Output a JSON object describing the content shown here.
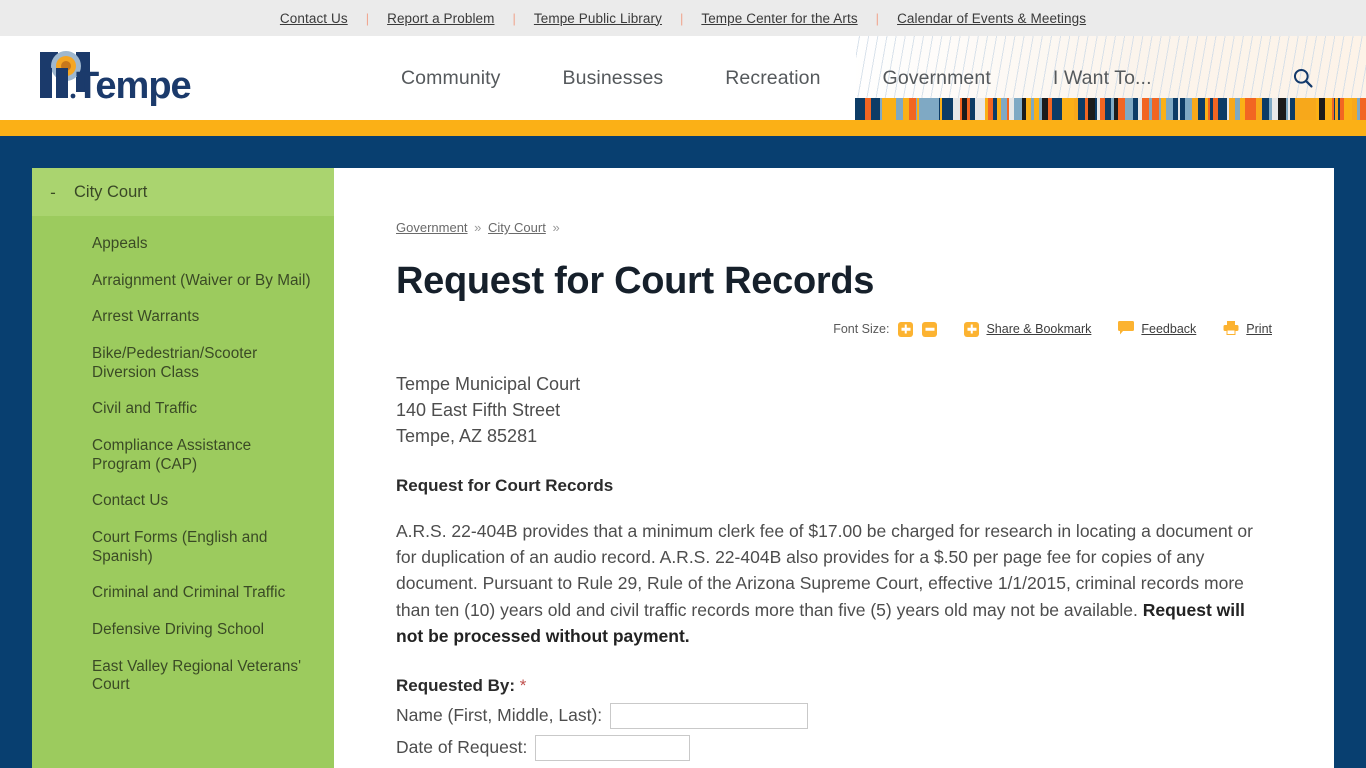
{
  "utility_bar": {
    "links": [
      "Contact Us",
      "Report a Problem",
      "Tempe Public Library",
      "Tempe Center for the Arts",
      "Calendar of Events & Meetings"
    ],
    "separator": "|"
  },
  "masthead": {
    "logo_text": "Tempe",
    "logo_mark": "tempe-city-logo",
    "nav": [
      "Community",
      "Businesses",
      "Recreation",
      "Government",
      "I Want To..."
    ],
    "search_icon": "search-icon"
  },
  "sidebar": {
    "section_title": "City Court",
    "toggle_symbol": "-",
    "items": [
      "Appeals",
      "Arraignment (Waiver or By Mail)",
      "Arrest Warrants",
      "Bike/Pedestrian/Scooter Diversion Class",
      "Civil and Traffic",
      "Compliance Assistance Program (CAP)",
      "Contact Us",
      "Court Forms (English and Spanish)",
      "Criminal and Criminal Traffic",
      "Defensive Driving School",
      "East Valley Regional Veterans' Court"
    ]
  },
  "breadcrumb": {
    "items": [
      "Government",
      "City Court"
    ],
    "separator": "»",
    "trailing": "»"
  },
  "page": {
    "title": "Request for Court Records"
  },
  "page_tools": {
    "font_size_label": "Font Size:",
    "increase_icon": "font-increase-icon",
    "decrease_icon": "font-decrease-icon",
    "share_icon": "share-plus-icon",
    "share_label": "Share & Bookmark",
    "feedback_icon": "feedback-speech-bubble-icon",
    "feedback_label": "Feedback",
    "print_icon": "printer-icon",
    "print_label": "Print"
  },
  "content": {
    "address": {
      "line1": "Tempe Municipal Court",
      "line2": "140 East Fifth Street",
      "line3": "Tempe, AZ 85281"
    },
    "sub_heading": "Request for Court Records",
    "paragraph_main": "A.R.S. 22-404B provides that a minimum clerk fee of $17.00 be charged for research in locating a document or for duplication of an audio record. A.R.S. 22-404B also provides for a $.50 per page fee for copies of any document. Pursuant to Rule 29, Rule of the Arizona Supreme Court, effective 1/1/2015, criminal records more than ten (10) years old and civil traffic records more than five (5) years old may not be available.",
    "paragraph_bold_tail": "Request will not be processed without payment.",
    "form": {
      "section_label": "Requested By:",
      "required_marker": "*",
      "fields": [
        {
          "label": "Name (First, Middle, Last):",
          "value": "",
          "placeholder": ""
        },
        {
          "label": "Date of Request:",
          "value": "",
          "placeholder": ""
        }
      ]
    }
  },
  "colors": {
    "navy": "#083f70",
    "gold": "#fbb016",
    "green": "#9ccb5e",
    "green_head": "#aad46f",
    "orange_icon": "#fcb331",
    "utility_bg": "#ebebeb"
  }
}
